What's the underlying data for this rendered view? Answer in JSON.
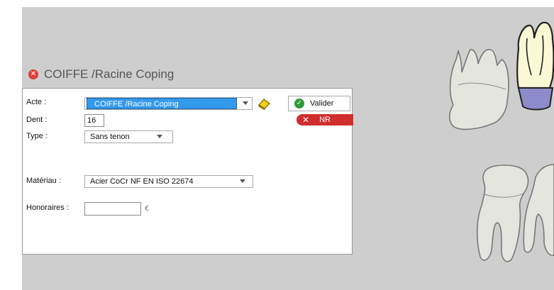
{
  "dialog": {
    "title": "COIFFE /Racine Coping",
    "close_icon": "close-icon",
    "fields": {
      "acte": {
        "label": "Acte :",
        "value": "COIFFE /Racine Coping"
      },
      "dent": {
        "label": "Dent :",
        "value": "16"
      },
      "type": {
        "label": "Type :",
        "value": "Sans tenon"
      },
      "materiau": {
        "label": "Matériau :",
        "value": "Acier CoCr NF EN ISO 22674"
      },
      "honoraires": {
        "label": "Honoraires :",
        "value": "",
        "unit": "€"
      }
    },
    "buttons": {
      "valider": "Valider",
      "nr": "NR"
    }
  },
  "colors": {
    "background": "#cecece",
    "selection": "#3399ea",
    "valider_icon": "#2c9a36",
    "nr_button": "#d12d2d",
    "crown_fill": "#8c8ccb"
  }
}
